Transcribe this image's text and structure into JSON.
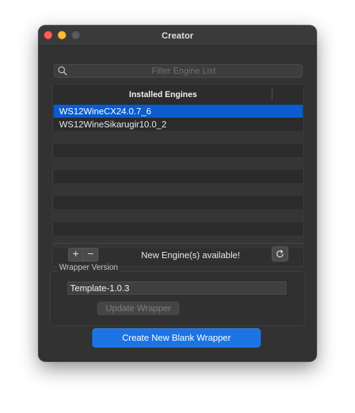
{
  "window": {
    "title": "Creator"
  },
  "search": {
    "placeholder": "Filter Engine List"
  },
  "engines": {
    "header": "Installed Engines",
    "items": [
      {
        "label": "WS12WineCX24.0.7_6",
        "selected": true
      },
      {
        "label": "WS12WineSikarugir10.0_2",
        "selected": false
      },
      {
        "label": ""
      },
      {
        "label": ""
      },
      {
        "label": ""
      },
      {
        "label": ""
      },
      {
        "label": ""
      },
      {
        "label": ""
      },
      {
        "label": ""
      },
      {
        "label": ""
      },
      {
        "label": ""
      }
    ],
    "add_label": "+",
    "remove_label": "−",
    "status": "New Engine(s) available!"
  },
  "wrapper": {
    "group_label": "Wrapper Version",
    "version": "Template-1.0.3",
    "update_label": "Update Wrapper"
  },
  "actions": {
    "create_label": "Create New Blank Wrapper"
  },
  "colors": {
    "selection": "#0a5ccf",
    "primary_button": "#1c74e4",
    "window_bg": "#323232"
  }
}
